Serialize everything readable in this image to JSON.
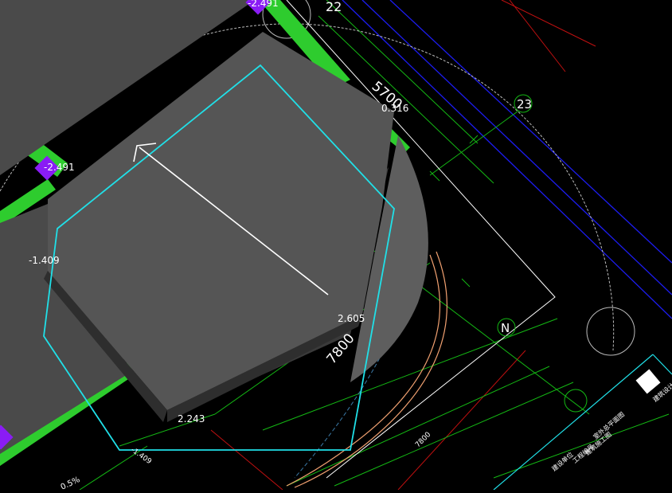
{
  "viewport": {
    "elevations": [
      "-2.491",
      "-2.491",
      "0.316",
      "-1.409",
      "2.605",
      "2.243"
    ],
    "slope_label": "-1.409",
    "slope_percent": "0.5%",
    "dimensions": [
      "5700",
      "7800",
      "7800"
    ],
    "grid_labels": [
      "22",
      "23",
      "N"
    ],
    "title_block": {
      "logo_letters": "建筑设计",
      "lines": [
        "室外总平面图",
        "建筑施工图",
        "工程编号",
        "建设单位"
      ]
    }
  },
  "colors": {
    "background": "#000000",
    "building_fill": "#555555",
    "building_side": "#3a3a3a",
    "curved_wall": "#5e5e5e",
    "green_path": "#2ecc2e",
    "cyan_outline": "#20e0e8",
    "blue_line": "#1c1cf0",
    "red_line": "#c01010",
    "green_line": "#14b814",
    "purple_marker": "#8a1cf5",
    "white_line": "#ffffff",
    "orange_curve": "#f0a070"
  }
}
